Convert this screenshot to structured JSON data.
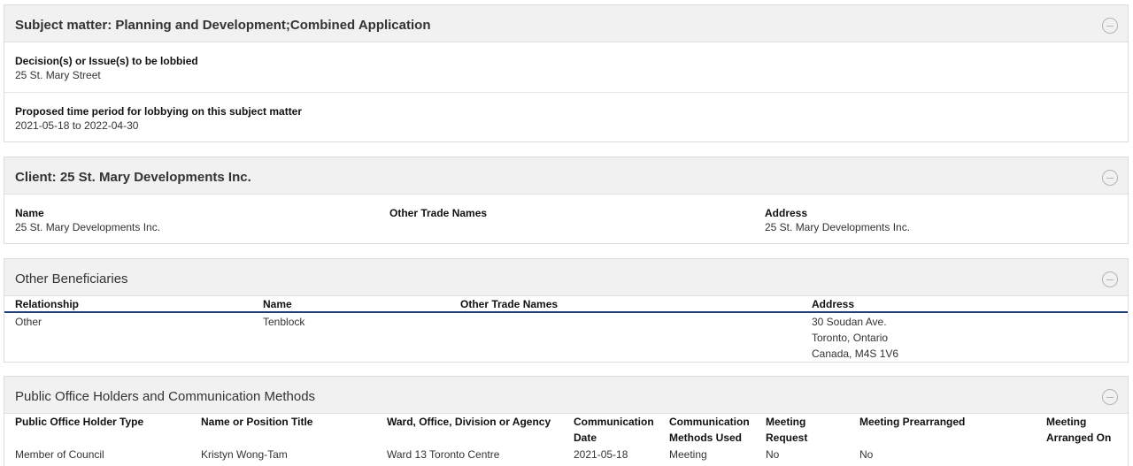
{
  "subject_panel": {
    "title": "Subject matter: Planning and Development;Combined Application",
    "decision_label": "Decision(s) or Issue(s) to be lobbied",
    "decision_value": "25 St. Mary Street",
    "period_label": "Proposed time period for lobbying on this subject matter",
    "period_value": "2021-05-18 to 2022-04-30"
  },
  "client_panel": {
    "title": "Client: 25 St. Mary Developments Inc.",
    "name_label": "Name",
    "name_value": "25 St. Mary Developments Inc.",
    "trade_label": "Other Trade Names",
    "trade_value": "",
    "address_label": "Address",
    "address_value": "25 St. Mary Developments Inc."
  },
  "beneficiaries_panel": {
    "title": "Other Beneficiaries",
    "columns": [
      "Relationship",
      "Name",
      "Other Trade Names",
      "Address"
    ],
    "rows": [
      {
        "relationship": "Other",
        "name": "Tenblock",
        "trade_names": "",
        "address_line1": "30 Soudan Ave.",
        "address_line2": "Toronto, Ontario",
        "address_line3": "Canada, M4S 1V6"
      }
    ]
  },
  "poh_panel": {
    "title": "Public Office Holders and Communication Methods",
    "columns": {
      "type": "Public Office Holder Type",
      "name": "Name or Position Title",
      "ward": "Ward, Office, Division or Agency",
      "comm_date_1": "Communication",
      "comm_date_2": "Date",
      "comm_methods_1": "Communication",
      "comm_methods_2": "Methods Used",
      "meeting_request_1": "Meeting",
      "meeting_request_2": "Request",
      "prearranged": "Meeting Prearranged",
      "arranged_on_1": "Meeting",
      "arranged_on_2": "Arranged On"
    },
    "rows": [
      {
        "type": "Member of Council",
        "name": "Kristyn Wong-Tam",
        "ward": "Ward 13 Toronto Centre",
        "comm_date": "2021-05-18",
        "comm_methods": "Meeting",
        "meeting_request": "No",
        "prearranged": "No",
        "arranged_on": ""
      }
    ]
  }
}
